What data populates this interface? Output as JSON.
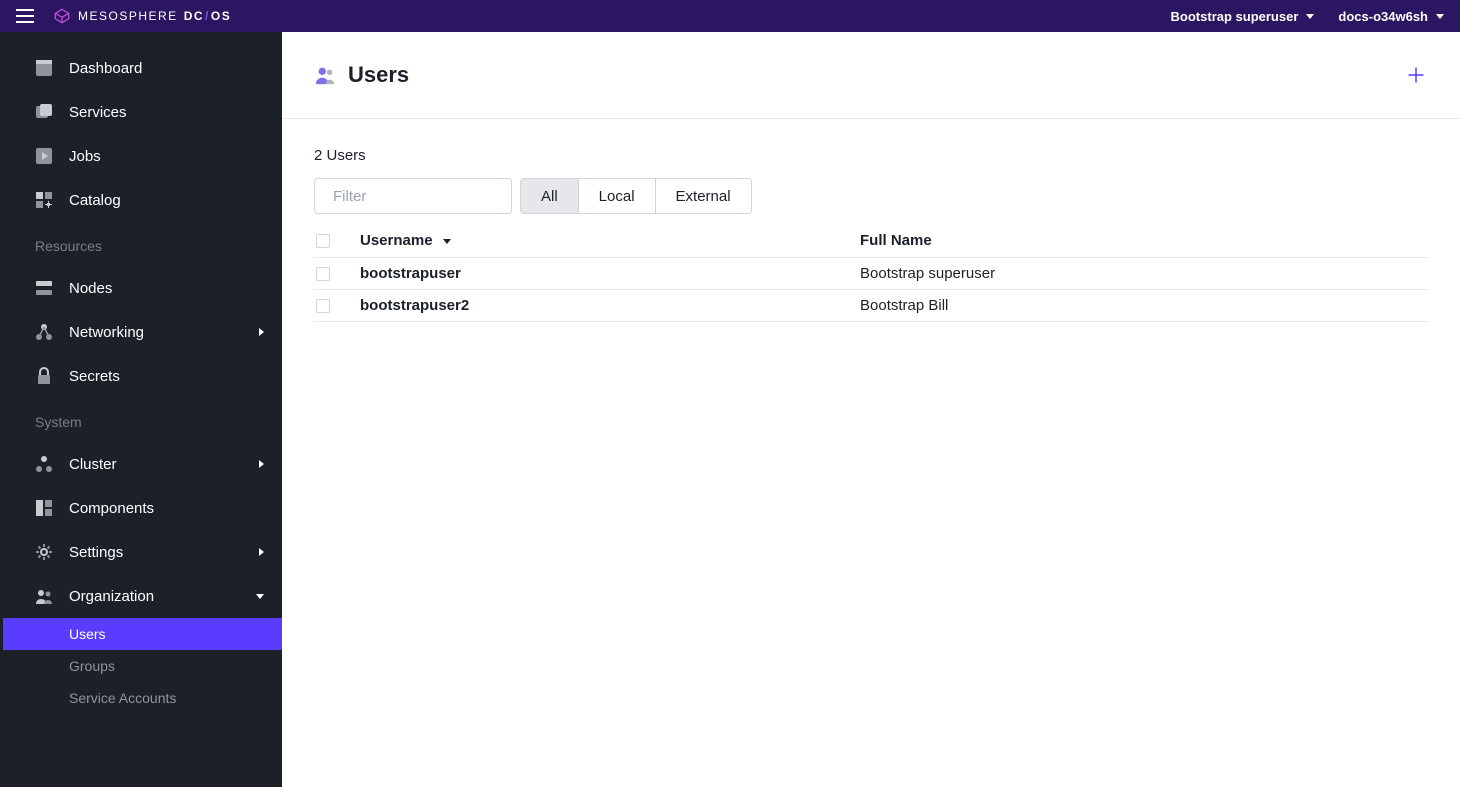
{
  "topbar": {
    "brand_text": "MESOSPHERE",
    "brand_dc": "DC",
    "brand_os": "OS",
    "user_label": "Bootstrap superuser",
    "cluster_label": "docs-o34w6sh"
  },
  "sidebar": {
    "top": [
      {
        "label": "Dashboard"
      },
      {
        "label": "Services"
      },
      {
        "label": "Jobs"
      },
      {
        "label": "Catalog"
      }
    ],
    "resources_heading": "Resources",
    "resources": [
      {
        "label": "Nodes"
      },
      {
        "label": "Networking",
        "expandable": true
      },
      {
        "label": "Secrets"
      }
    ],
    "system_heading": "System",
    "system": [
      {
        "label": "Cluster",
        "expandable": true
      },
      {
        "label": "Components"
      },
      {
        "label": "Settings",
        "expandable": true
      },
      {
        "label": "Organization",
        "expandable": true,
        "expanded": true,
        "children": [
          {
            "label": "Users",
            "active": true
          },
          {
            "label": "Groups"
          },
          {
            "label": "Service Accounts"
          }
        ]
      }
    ]
  },
  "page": {
    "title": "Users",
    "count_label": "2 Users",
    "filter_placeholder": "Filter",
    "segments": [
      {
        "label": "All",
        "active": true
      },
      {
        "label": "Local"
      },
      {
        "label": "External"
      }
    ],
    "columns": {
      "username": "Username",
      "fullname": "Full Name"
    },
    "rows": [
      {
        "username": "bootstrapuser",
        "fullname": "Bootstrap superuser"
      },
      {
        "username": "bootstrapuser2",
        "fullname": "Bootstrap Bill"
      }
    ]
  }
}
